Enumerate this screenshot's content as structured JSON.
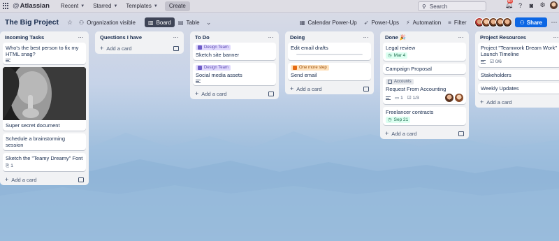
{
  "topnav": {
    "brand": "Atlassian",
    "items": [
      {
        "label": "Recent"
      },
      {
        "label": "Starred"
      },
      {
        "label": "Templates"
      }
    ],
    "create_label": "Create",
    "search_placeholder": "Search",
    "notif_count": "9+"
  },
  "board": {
    "title": "The Big Project",
    "visibility": "Organization visible",
    "views": {
      "board": "Board",
      "table": "Table"
    },
    "powerups": {
      "calendar": "Calendar Power-Up",
      "powerups": "Power-Ups",
      "automation": "Automation",
      "filter": "Filter"
    },
    "share_label": "Share"
  },
  "lists": [
    {
      "title": "Incoming Tasks",
      "add_label": "Add a card",
      "cards": [
        {
          "title": "Who's the best person to fix my HTML snag?"
        },
        {
          "title": "Super secret document"
        },
        {
          "title": "Schedule a brainstorming session"
        },
        {
          "title": "Sketch the \"Teamy Dreamy\" Font",
          "attachments": "1"
        }
      ]
    },
    {
      "title": "Questions I have",
      "add_label": "Add a card",
      "cards": []
    },
    {
      "title": "To Do",
      "add_label": "Add a card",
      "cards": [
        {
          "label": "Design Team",
          "title": "Sketch site banner"
        },
        {
          "label": "Design Team",
          "title": "Social media assets"
        }
      ]
    },
    {
      "title": "Doing",
      "add_label": "Add a card",
      "cards": [
        {
          "title": "Edit email drafts"
        },
        {
          "label": "One more step",
          "title": "Send email"
        }
      ]
    },
    {
      "title": "Done 🎉",
      "add_label": "Add a card",
      "cards": [
        {
          "title": "Legal review",
          "date": "Mar 4"
        },
        {
          "title": "Campaign Proposal"
        },
        {
          "label": "Accounts",
          "title": "Request From Accounting",
          "comments": "1",
          "checklist": "1/3"
        },
        {
          "title": "Freelancer contracts",
          "date": "Sep 21"
        }
      ]
    },
    {
      "title": "Project Resources",
      "add_label": "Add a card",
      "cards": [
        {
          "title": "Project \"Teamwork Dream Work\" Launch Timeline",
          "checklist": "0/6"
        },
        {
          "title": "Stakeholders"
        },
        {
          "title": "Weekly Updates"
        }
      ]
    }
  ],
  "colors": {
    "share_blue": "#0c66e4",
    "label_purple": "#dfd8fd",
    "date_green": "#dcfff1",
    "label_orange": "#ffe2bd"
  }
}
